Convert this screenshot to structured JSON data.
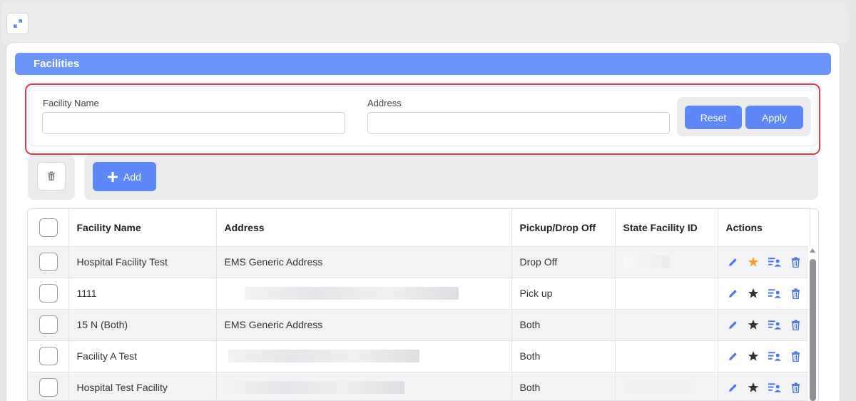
{
  "section": {
    "title": "Facilities"
  },
  "filters": {
    "facility_name_label": "Facility Name",
    "facility_name_value": "",
    "address_label": "Address",
    "address_value": "",
    "reset_label": "Reset",
    "apply_label": "Apply"
  },
  "toolbar": {
    "add_label": "Add"
  },
  "table": {
    "columns": [
      "Facility Name",
      "Address",
      "Pickup/Drop Off",
      "State Facility ID",
      "Actions"
    ],
    "rows": [
      {
        "name": "Hospital Facility Test",
        "address": "EMS Generic Address",
        "pickup": "Drop Off",
        "favorite": true
      },
      {
        "name": "1111",
        "address": "",
        "pickup": "Pick up",
        "favorite": false
      },
      {
        "name": "15 N (Both)",
        "address": "EMS Generic Address",
        "pickup": "Both",
        "favorite": false
      },
      {
        "name": "Facility A Test",
        "address": "",
        "pickup": "Both",
        "favorite": false
      },
      {
        "name": "Hospital Test Facility",
        "address": "",
        "pickup": "Both",
        "favorite": false
      }
    ]
  },
  "colors": {
    "accent": "#5e87f7",
    "header": "#6b95f9",
    "highlight": "#e03a46",
    "favorite": "#f5a623",
    "icon": "#4a74e8"
  },
  "icons": [
    "expand-icon",
    "trash-icon",
    "plus-icon",
    "edit-icon",
    "star-icon",
    "assign-user-icon",
    "delete-icon"
  ]
}
